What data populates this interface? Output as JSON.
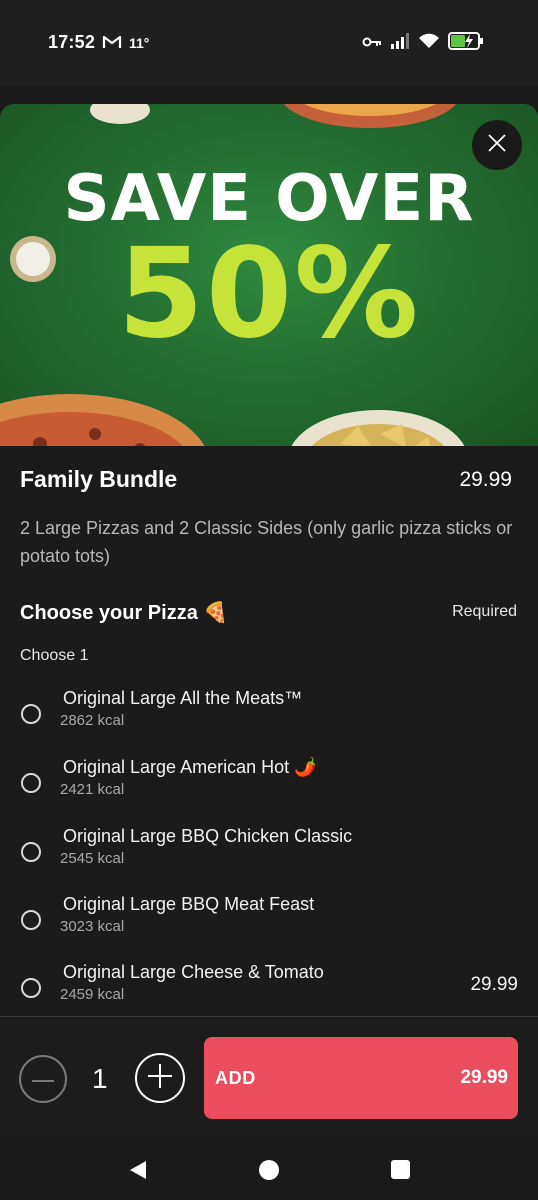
{
  "status_bar": {
    "time": "17:52",
    "mail_icon": "gmail-icon",
    "temperature": "11°"
  },
  "banner": {
    "line1": "SAVE OVER",
    "line2": "50%",
    "colors": {
      "background": "#246e31",
      "line1": "#ffffff",
      "line2": "#c6e33a"
    }
  },
  "product": {
    "title": "Family Bundle",
    "price": "29.99",
    "description": "2 Large Pizzas and 2 Classic Sides (only garlic pizza sticks or potato tots)"
  },
  "section": {
    "title": "Choose your Pizza 🍕",
    "required_label": "Required",
    "choose_label": "Choose 1"
  },
  "options": [
    {
      "name": "Original Large All the Meats™",
      "kcal": "2862 kcal",
      "price": ""
    },
    {
      "name": "Original Large American Hot 🌶️",
      "kcal": "2421 kcal",
      "price": ""
    },
    {
      "name": "Original Large BBQ Chicken Classic",
      "kcal": "2545 kcal",
      "price": ""
    },
    {
      "name": "Original Large BBQ Meat Feast",
      "kcal": "3023 kcal",
      "price": ""
    },
    {
      "name": "Original Large Cheese & Tomato",
      "kcal": "2459 kcal",
      "price": "29.99"
    }
  ],
  "bottom": {
    "quantity": "1",
    "add_label": "ADD",
    "add_price": "29.99",
    "accent_color": "#ea4d5b"
  }
}
